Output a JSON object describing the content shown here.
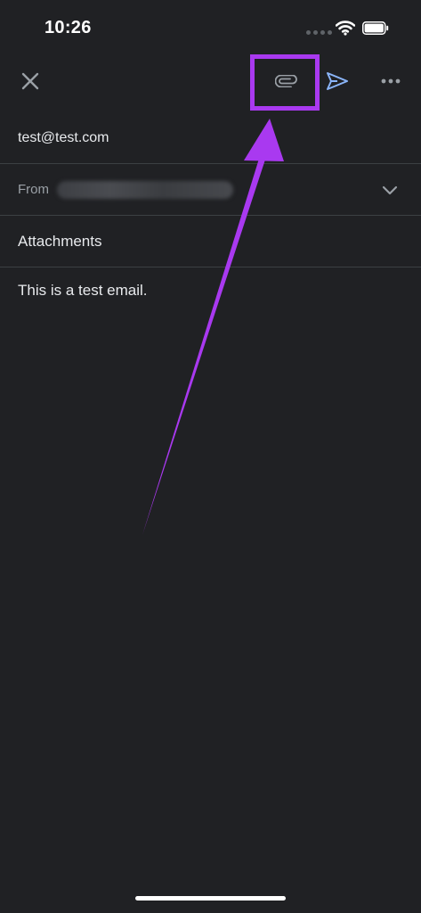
{
  "status_bar": {
    "time": "10:26",
    "icons": [
      "cellular-signal-icon",
      "wifi-icon",
      "battery-icon"
    ]
  },
  "toolbar": {
    "icons": [
      "close-icon",
      "paperclip-icon",
      "send-icon",
      "more-vert-icon"
    ],
    "send_color": "#8ab4f8"
  },
  "compose": {
    "to": "test@test.com",
    "from_label": "From",
    "subject": "Attachments",
    "body": "This is a test email."
  },
  "annotation": {
    "color": "#a939f0",
    "target": "attach-button"
  }
}
